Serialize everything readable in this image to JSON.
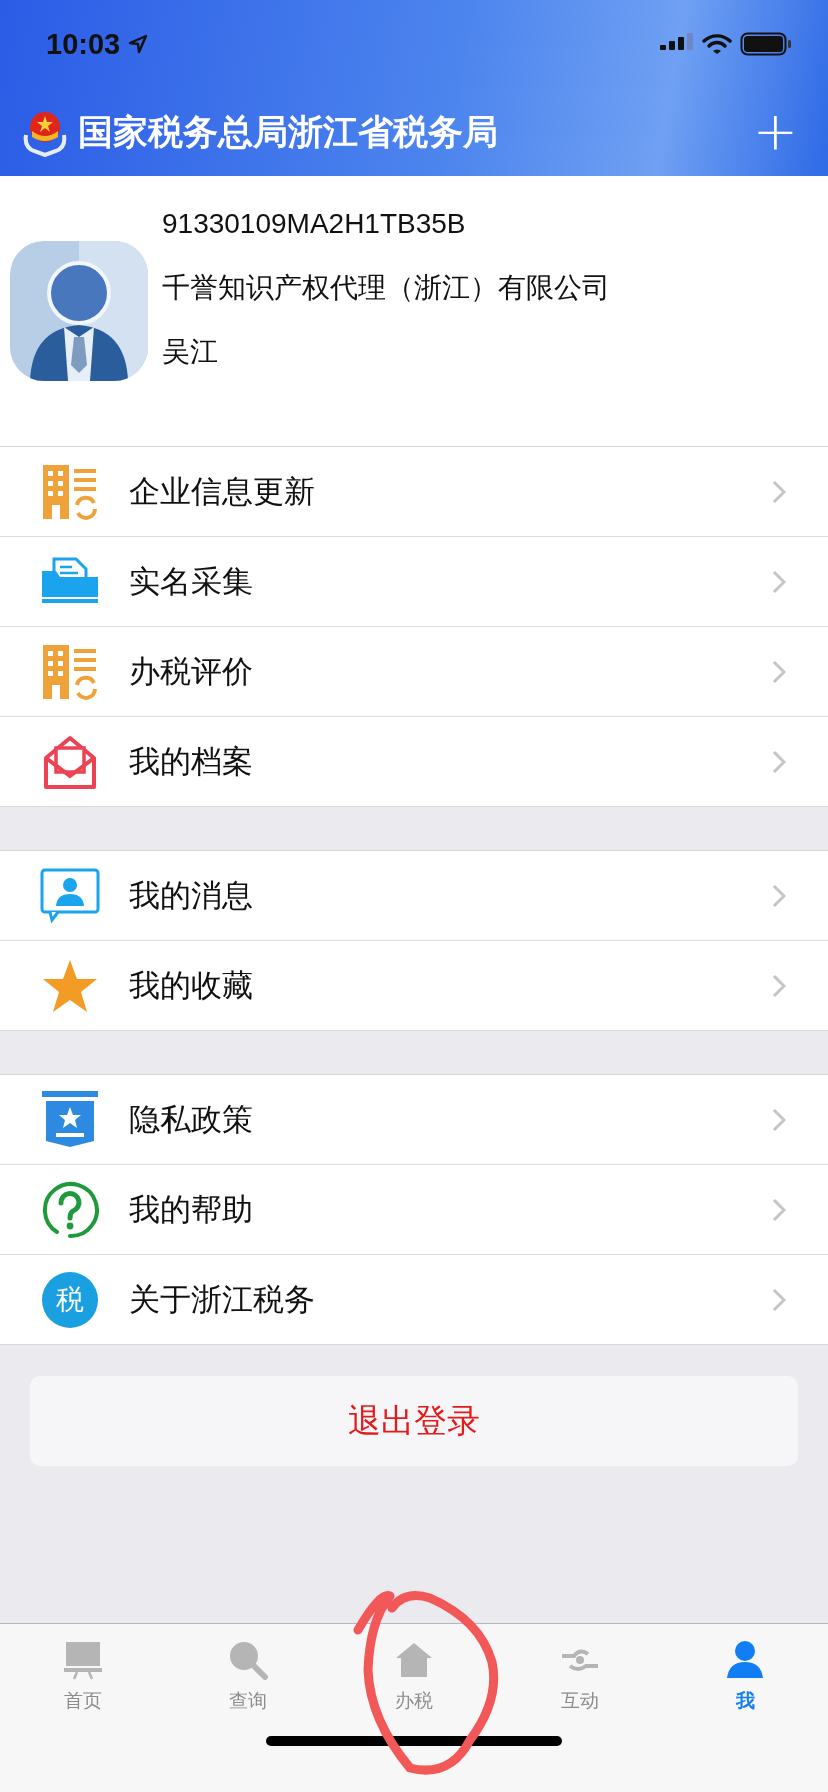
{
  "status_bar": {
    "time": "10:03"
  },
  "header": {
    "title": "国家税务总局浙江省税务局",
    "action": "+"
  },
  "profile": {
    "tax_id": "91330109MA2H1TB35B",
    "company": "千誉知识产权代理（浙江）有限公司",
    "name": "吴江"
  },
  "menu_groups": [
    [
      {
        "label": "企业信息更新",
        "kind": "building"
      },
      {
        "label": "实名采集",
        "kind": "folder"
      },
      {
        "label": "办税评价",
        "kind": "building"
      },
      {
        "label": "我的档案",
        "kind": "envelope"
      }
    ],
    [
      {
        "label": "我的消息",
        "kind": "message"
      },
      {
        "label": "我的收藏",
        "kind": "star"
      }
    ],
    [
      {
        "label": "隐私政策",
        "kind": "privacy"
      },
      {
        "label": "我的帮助",
        "kind": "help"
      },
      {
        "label": "关于浙江税务",
        "kind": "tax",
        "badge": "税"
      }
    ]
  ],
  "logout_button": "退出登录",
  "tabs": [
    {
      "label": "首页",
      "kind": "board",
      "selected": false
    },
    {
      "label": "查询",
      "kind": "search",
      "selected": false
    },
    {
      "label": "办税",
      "kind": "house",
      "selected": false
    },
    {
      "label": "互动",
      "kind": "hands",
      "selected": false
    },
    {
      "label": "我",
      "kind": "person",
      "selected": true
    }
  ],
  "annotation": {
    "kind": "freehand-circle"
  }
}
